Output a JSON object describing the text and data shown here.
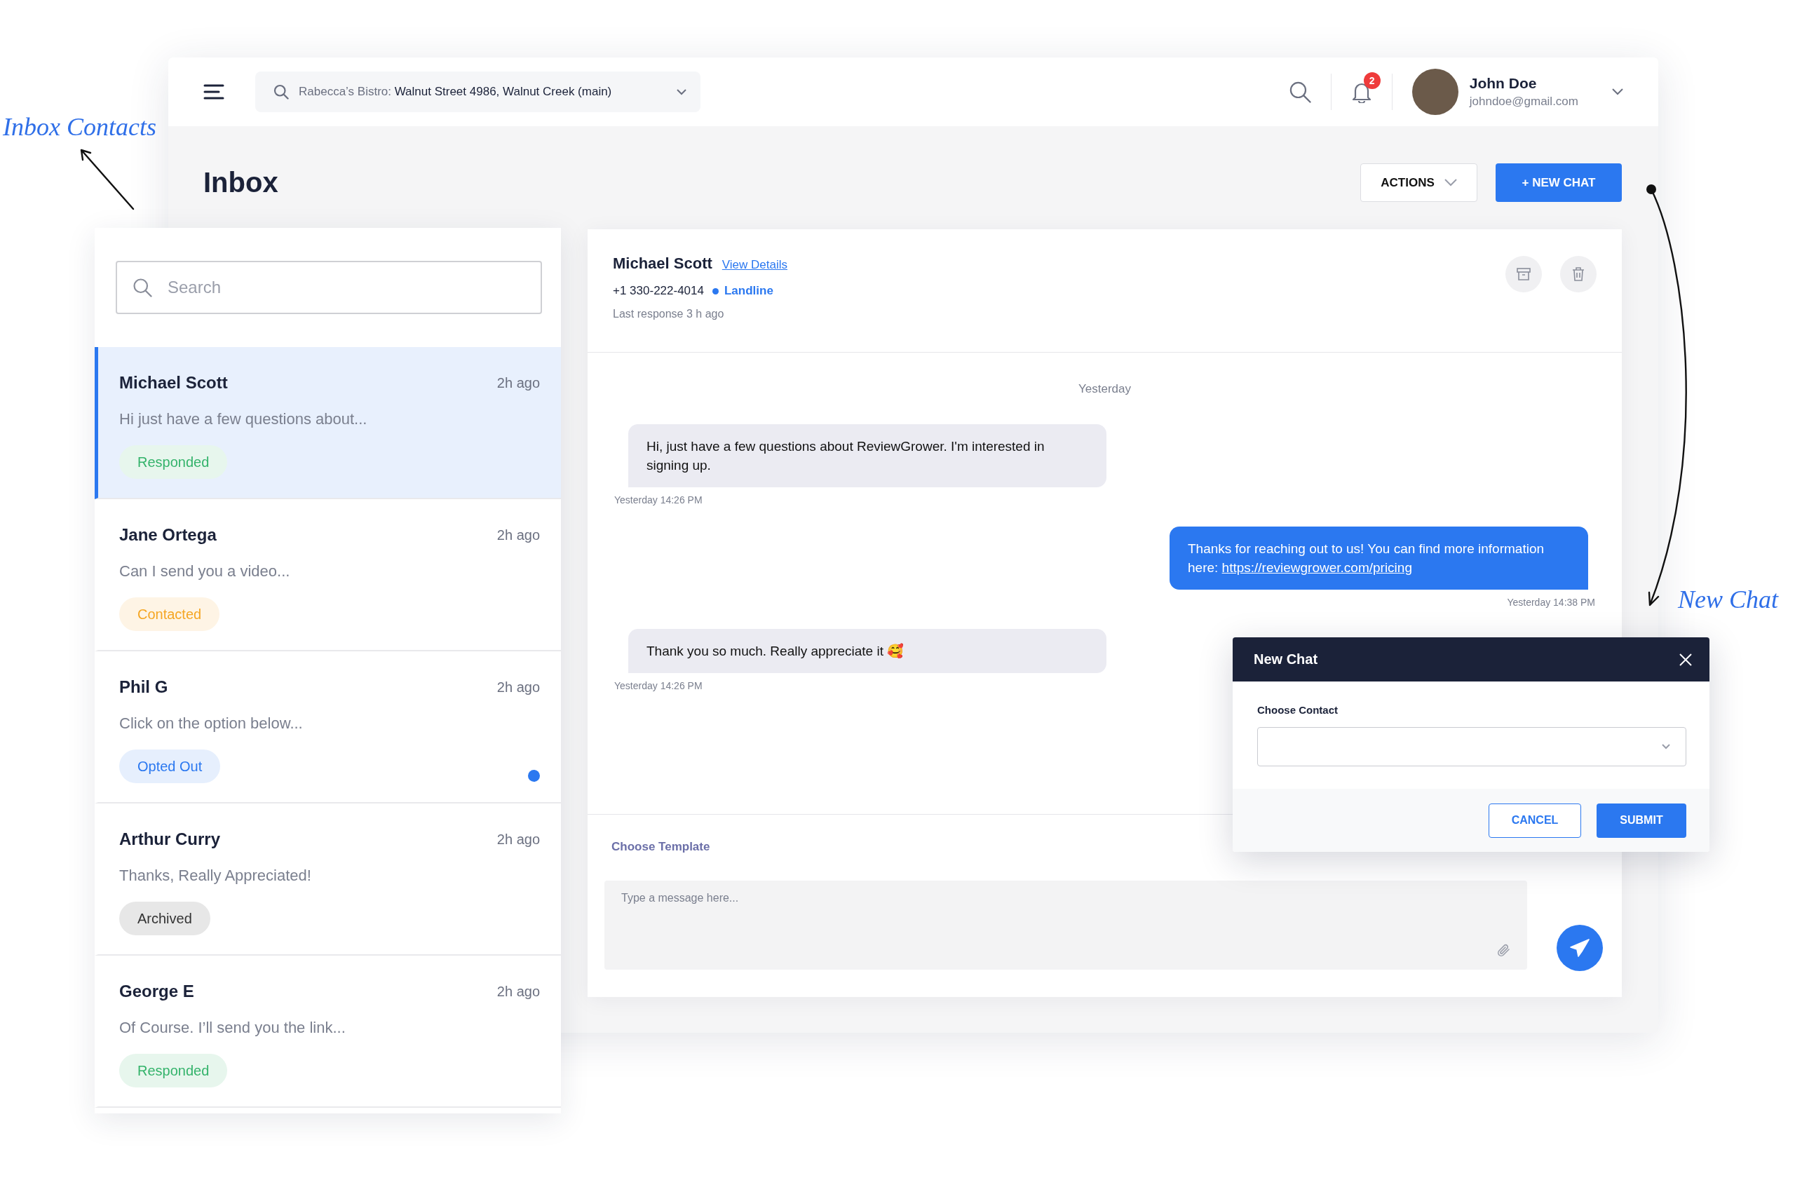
{
  "annotations": {
    "inbox_contacts": "Inbox Contacts",
    "new_chat": "New Chat"
  },
  "header": {
    "location_prefix": "Rabecca’s Bistro:",
    "location": "Walnut Street 4986, Walnut Creek (main)",
    "notification_count": "2",
    "user": {
      "name": "John Doe",
      "email": "johndoe@gmail.com"
    }
  },
  "page": {
    "title": "Inbox",
    "actions": "ACTIONS",
    "new_chat": "+ NEW CHAT"
  },
  "contacts": {
    "search_placeholder": "Search",
    "items": [
      {
        "name": "Michael Scott",
        "time": "2h ago",
        "preview": "Hi just have a few questions about...",
        "status": "Responded",
        "color": "#34b36b",
        "selected": true,
        "unread": false
      },
      {
        "name": "Jane Ortega",
        "time": "2h ago",
        "preview": "Can I send you a video...",
        "status": "Contacted",
        "color": "#f5a623",
        "selected": false,
        "unread": false
      },
      {
        "name": "Phil G",
        "time": "2h ago",
        "preview": "Click on the option below...",
        "status": "Opted Out",
        "color": "#2b78f0",
        "selected": false,
        "unread": true
      },
      {
        "name": "Arthur Curry",
        "time": "2h ago",
        "preview": "Thanks, Really Appreciated!",
        "status": "Archived",
        "color": "#333333",
        "selected": false,
        "unread": false
      },
      {
        "name": "George E",
        "time": "2h ago",
        "preview": "Of Course. I’ll send you the link...",
        "status": "Responded",
        "color": "#34b36b",
        "selected": false,
        "unread": false
      }
    ]
  },
  "chat": {
    "name": "Michael Scott",
    "view_details": "View Details",
    "phone": "+1 330-222-4014",
    "line_type": "Landline",
    "last_response": "Last response 3 h ago",
    "day": "Yesterday",
    "messages": [
      {
        "kind": "incoming",
        "text": "Hi, just have a few questions about ReviewGrower. I'm interested in signing up.",
        "time": "Yesterday 14:26 PM"
      },
      {
        "kind": "outgoing",
        "text": "Thanks for reaching out to us! You can find more information here: ",
        "link": "https://reviewgrower.com/pricing",
        "time": "Yesterday 14:38 PM"
      },
      {
        "kind": "incoming",
        "text": "Thank you so much. Really appreciate it 🥰",
        "time": "Yesterday 14:26 PM"
      }
    ],
    "template": "Choose Template",
    "message_placeholder": "Type a message here..."
  },
  "dialog": {
    "title": "New Chat",
    "field_label": "Choose Contact",
    "buttons": [
      {
        "label": "CANCEL",
        "kind": "secondary"
      },
      {
        "label": "SUBMIT",
        "kind": "primary"
      }
    ]
  }
}
